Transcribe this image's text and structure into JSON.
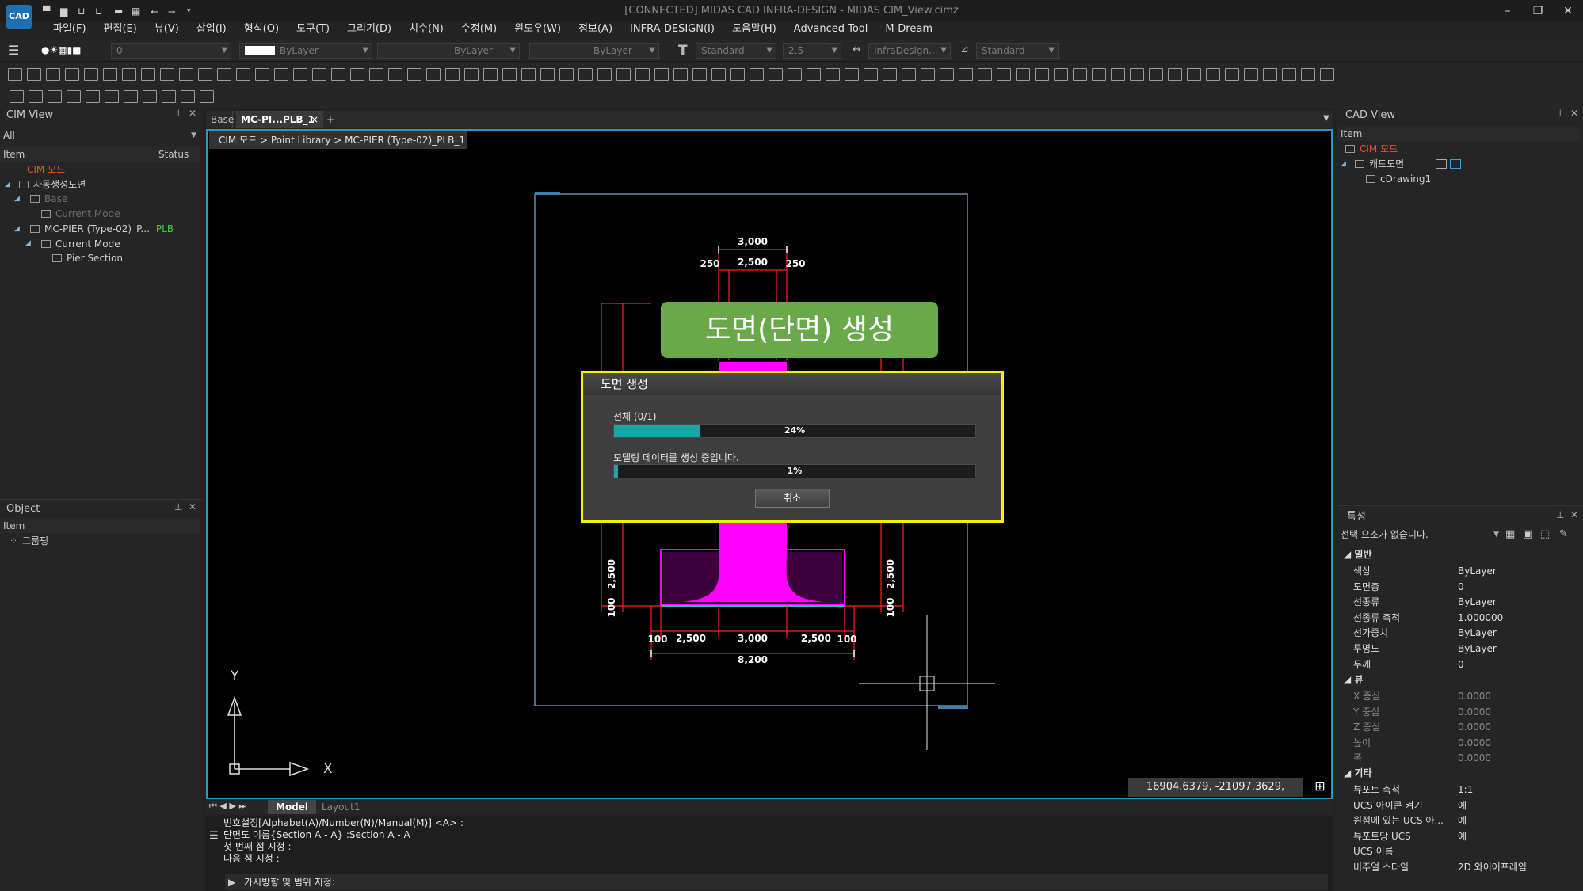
{
  "window": {
    "logo": "CAD",
    "title": "[CONNECTED] MIDAS CAD INFRA-DESIGN - MIDAS CIM_View.cimz",
    "minimize": "–",
    "restore": "❐",
    "close": "✕"
  },
  "menu": [
    "파일(F)",
    "편집(E)",
    "뷰(V)",
    "삽입(I)",
    "형식(O)",
    "도구(T)",
    "그리기(D)",
    "치수(N)",
    "수정(M)",
    "윈도우(W)",
    "정보(A)",
    "INFRA-DESIGN(I)",
    "도움말(H)",
    "Advanced Tool",
    "M-Dream"
  ],
  "toolbar": {
    "layer_value": "0",
    "color_value": "ByLayer",
    "linetype_value": "ByLayer",
    "lineweight_value": "ByLayer",
    "textstyle_value": "Standard",
    "textheight_value": "2.5",
    "dimstyle_value": "InfraDesign...",
    "tablestyle_value": "Standard"
  },
  "cim_view": {
    "title": "CIM View",
    "filter": "All",
    "col_item": "Item",
    "col_status": "Status",
    "tree": [
      {
        "label": "CIM 모드",
        "color": "#e8532a"
      },
      {
        "label": "자동생성도면"
      },
      {
        "label": "Base"
      },
      {
        "label": "Current Mode"
      },
      {
        "label": "MC-PIER (Type-02)_P...",
        "status": "PLB"
      },
      {
        "label": "Current Mode"
      },
      {
        "label": "Pier Section"
      }
    ]
  },
  "object_panel": {
    "title": "Object",
    "col_item": "Item",
    "items": [
      {
        "label": "그룹핑"
      }
    ]
  },
  "doc_tabs": {
    "tabs": [
      "Base",
      "MC-PI...PLB_1"
    ],
    "close": "×",
    "add": "+"
  },
  "breadcrumb": "CIM 모드 > Point Library > MC-PIER (Type-02)_PLB_1",
  "drawing": {
    "dims_top": [
      "3,000",
      "250",
      "2,500",
      "250"
    ],
    "dims_bottom": [
      "100",
      "2,500",
      "3,000",
      "2,500",
      "100"
    ],
    "dim_total": "8,200",
    "dims_side_left": [
      "2,500",
      "100"
    ],
    "dims_side_right": [
      "2,500",
      "100"
    ],
    "axis_y": "Y",
    "axis_x": "X"
  },
  "coords": "16904.6379, -21097.3629, 0.0000",
  "banner": "도면(단면) 생성",
  "dialog": {
    "title": "도면 생성",
    "progress1_label": "전체 (0/1)",
    "progress1_value": 24,
    "progress1_text": "24%",
    "progress2_label": "모델링 데이터를 생성 중입니다.",
    "progress2_value": 1,
    "progress2_text": "1%",
    "cancel": "취소"
  },
  "layout_tabs": [
    "Model",
    "Layout1"
  ],
  "command": {
    "lines": [
      "번호설정[Alphabet(A)/Number(N)/Manual(M)] <A> :",
      "단면도 이름{Section A - A} :Section A - A",
      "첫 번째 점 지정 :",
      "다음 점 지정 :"
    ],
    "prompt": "가시방향 및 범위 지정:"
  },
  "cad_view": {
    "title": "CAD View",
    "col_item": "Item",
    "tree": [
      {
        "label": "CIM 모드",
        "color": "#e8532a"
      },
      {
        "label": "캐드도면"
      },
      {
        "label": "cDrawing1"
      }
    ]
  },
  "properties": {
    "title": "특성",
    "selection": "선택 요소가 없습니다.",
    "sections": {
      "general": "일반",
      "view": "뷰",
      "misc": "기타"
    },
    "general": [
      {
        "k": "색상",
        "v": "ByLayer"
      },
      {
        "k": "도면층",
        "v": "0"
      },
      {
        "k": "선종류",
        "v": "ByLayer"
      },
      {
        "k": "선종류 축척",
        "v": "1.000000"
      },
      {
        "k": "선가중치",
        "v": "ByLayer"
      },
      {
        "k": "투명도",
        "v": "ByLayer"
      },
      {
        "k": "두께",
        "v": "0"
      }
    ],
    "view": [
      {
        "k": "X 중심",
        "v": "0.0000"
      },
      {
        "k": "Y 중심",
        "v": "0.0000"
      },
      {
        "k": "Z 중심",
        "v": "0.0000"
      },
      {
        "k": "높이",
        "v": "0.0000"
      },
      {
        "k": "폭",
        "v": "0.0000"
      }
    ],
    "misc": [
      {
        "k": "뷰포트 축척",
        "v": "1:1"
      },
      {
        "k": "UCS 아이콘 켜기",
        "v": "예"
      },
      {
        "k": "원점에 있는 UCS 아...",
        "v": "예"
      },
      {
        "k": "뷰포트당 UCS",
        "v": "예"
      },
      {
        "k": "UCS 이름",
        "v": ""
      },
      {
        "k": "비주얼 스타일",
        "v": "2D 와이어프레임"
      }
    ]
  }
}
